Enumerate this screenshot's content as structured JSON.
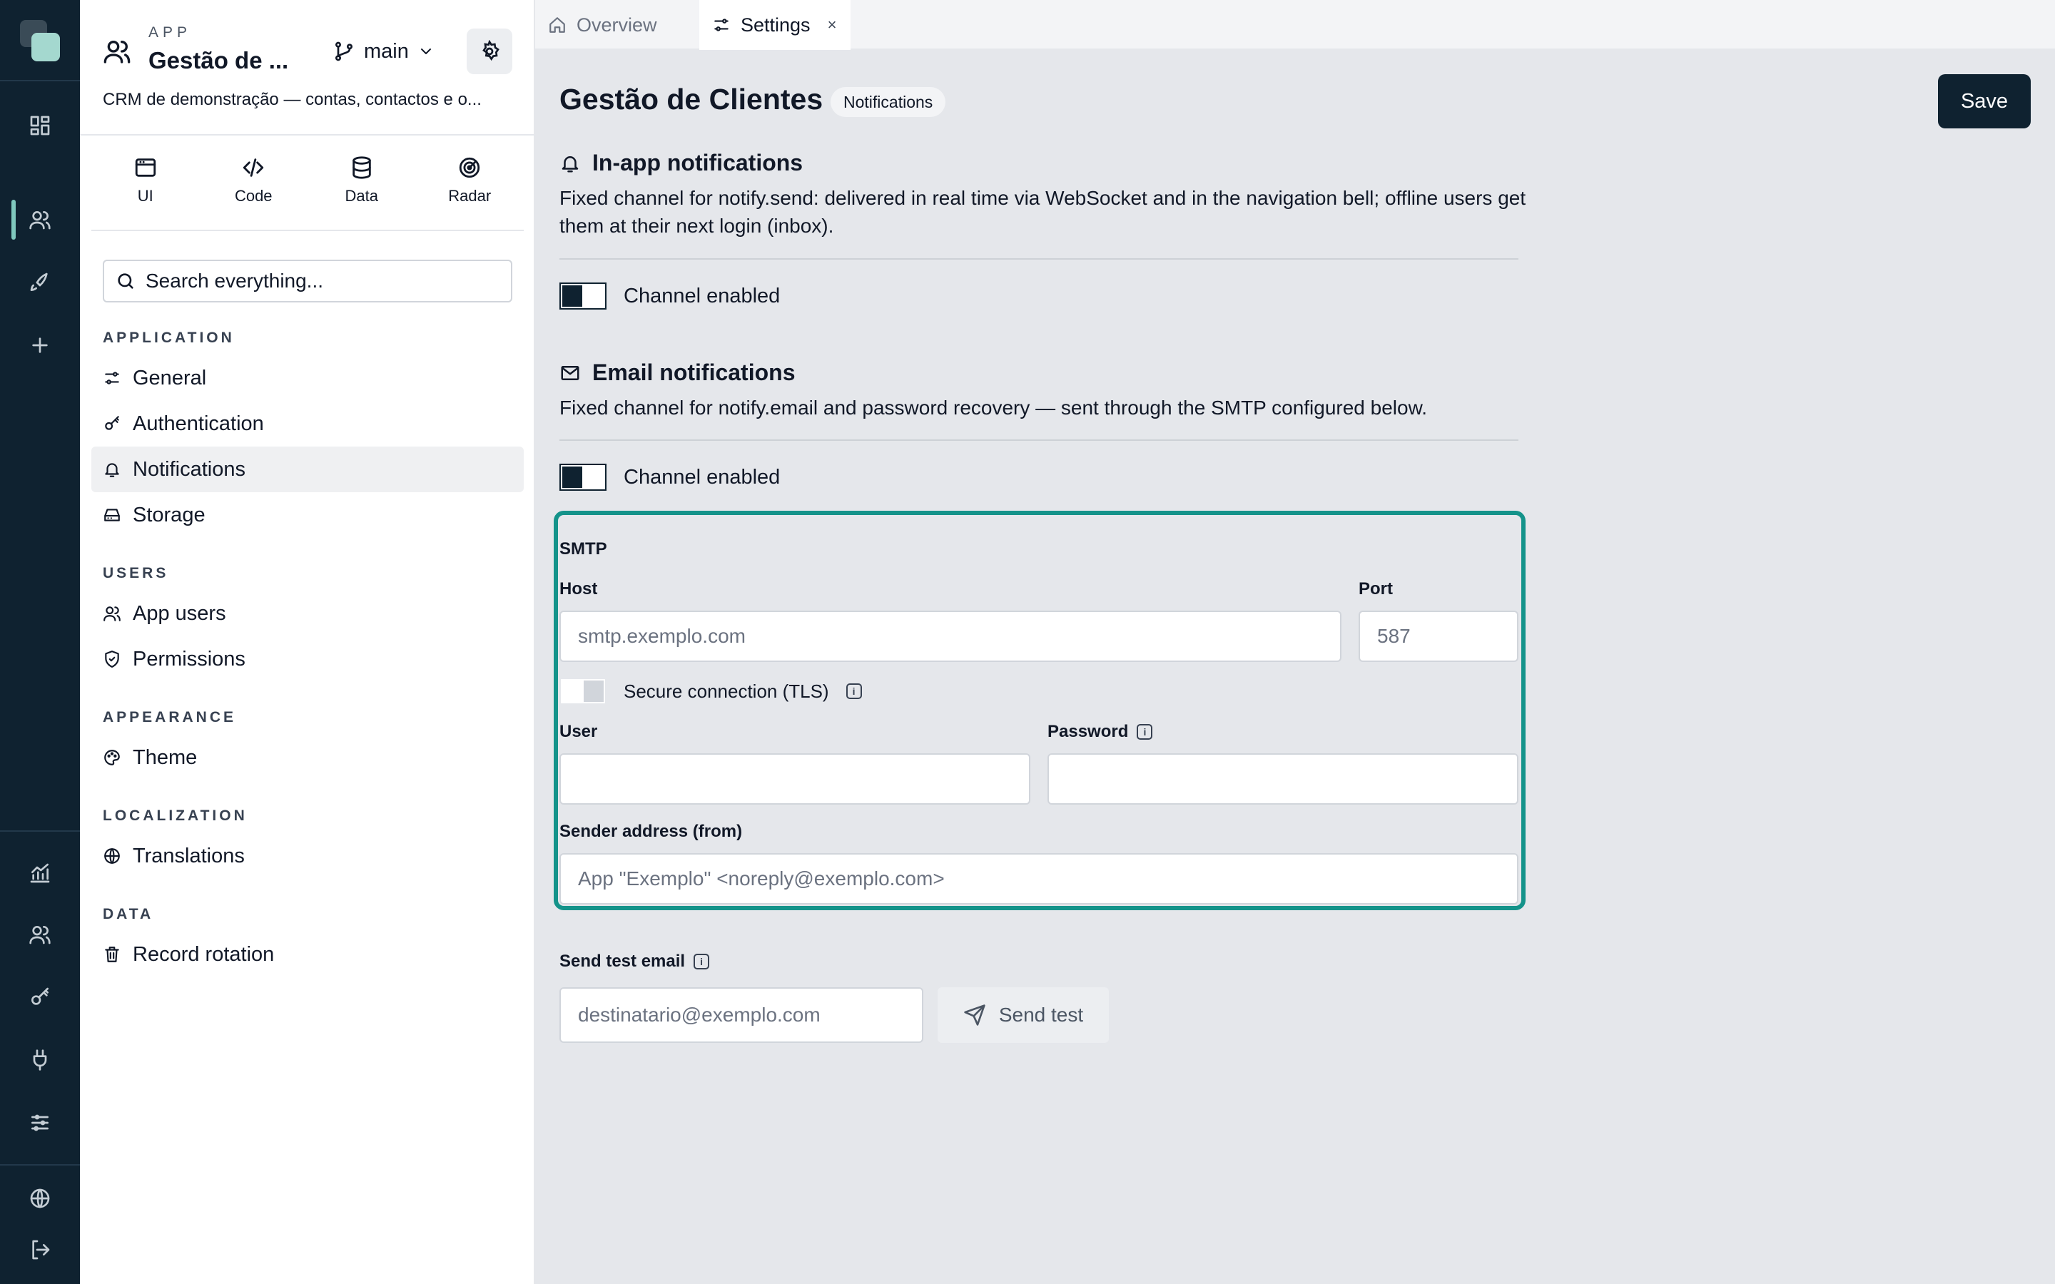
{
  "rail": {
    "icons": [
      "app-logo",
      "dashboard-icon",
      "users-icon",
      "rocket-icon",
      "plus-icon",
      "analytics-icon",
      "team-icon",
      "key-icon",
      "plug-icon",
      "sliders-icon",
      "globe-icon",
      "logout-icon"
    ],
    "accent": "#7fc8bd"
  },
  "app": {
    "kicker": "APP",
    "name": "Gestão de ...",
    "branch": "main",
    "description": "CRM de demonstração — contas, contactos e o..."
  },
  "modes": [
    {
      "label": "UI",
      "icon": "window-icon"
    },
    {
      "label": "Code",
      "icon": "code-icon"
    },
    {
      "label": "Data",
      "icon": "database-icon"
    },
    {
      "label": "Radar",
      "icon": "radar-icon"
    }
  ],
  "search": {
    "placeholder": "Search everything..."
  },
  "nav": {
    "application": {
      "title": "APPLICATION",
      "items": [
        {
          "label": "General",
          "icon": "sliders-icon"
        },
        {
          "label": "Authentication",
          "icon": "key-icon"
        },
        {
          "label": "Notifications",
          "icon": "bell-icon",
          "active": true
        },
        {
          "label": "Storage",
          "icon": "drive-icon"
        }
      ]
    },
    "users": {
      "title": "USERS",
      "items": [
        {
          "label": "App users",
          "icon": "users-icon"
        },
        {
          "label": "Permissions",
          "icon": "shield-icon"
        }
      ]
    },
    "appearance": {
      "title": "APPEARANCE",
      "items": [
        {
          "label": "Theme",
          "icon": "palette-icon"
        }
      ]
    },
    "localization": {
      "title": "LOCALIZATION",
      "items": [
        {
          "label": "Translations",
          "icon": "globe-icon"
        }
      ]
    },
    "data": {
      "title": "DATA",
      "items": [
        {
          "label": "Record rotation",
          "icon": "trash-icon"
        }
      ]
    }
  },
  "tabs": [
    {
      "label": "Overview",
      "icon": "home-icon",
      "active": false
    },
    {
      "label": "Settings",
      "icon": "sliders-icon",
      "active": true,
      "close": "×"
    }
  ],
  "page": {
    "title": "Gestão de Clientes",
    "badge": "Notifications",
    "save_label": "Save"
  },
  "inapp": {
    "title": "In-app notifications",
    "description": "Fixed channel for notify.send: delivered in real time via WebSocket and in the navigation bell; offline users get them at their next login (inbox).",
    "toggle_label": "Channel enabled",
    "enabled": true
  },
  "email": {
    "title": "Email notifications",
    "description": "Fixed channel for notify.email and password recovery — sent through the SMTP configured below.",
    "toggle_label": "Channel enabled",
    "enabled": true
  },
  "smtp": {
    "title": "SMTP",
    "host_label": "Host",
    "host_placeholder": "smtp.exemplo.com",
    "host_value": "",
    "port_label": "Port",
    "port_placeholder": "587",
    "port_value": "",
    "tls_label": "Secure connection (TLS)",
    "tls_enabled": false,
    "user_label": "User",
    "user_value": "",
    "password_label": "Password",
    "password_value": "",
    "from_label": "Sender address (from)",
    "from_placeholder": "App \"Exemplo\" <noreply@exemplo.com>",
    "from_value": "",
    "accent_color": "#14938a"
  },
  "test": {
    "label": "Send test email",
    "placeholder": "destinatario@exemplo.com",
    "value": "",
    "button_label": "Send test"
  },
  "colors": {
    "rail_bg": "#0f2230",
    "primary": "#0f2230"
  }
}
